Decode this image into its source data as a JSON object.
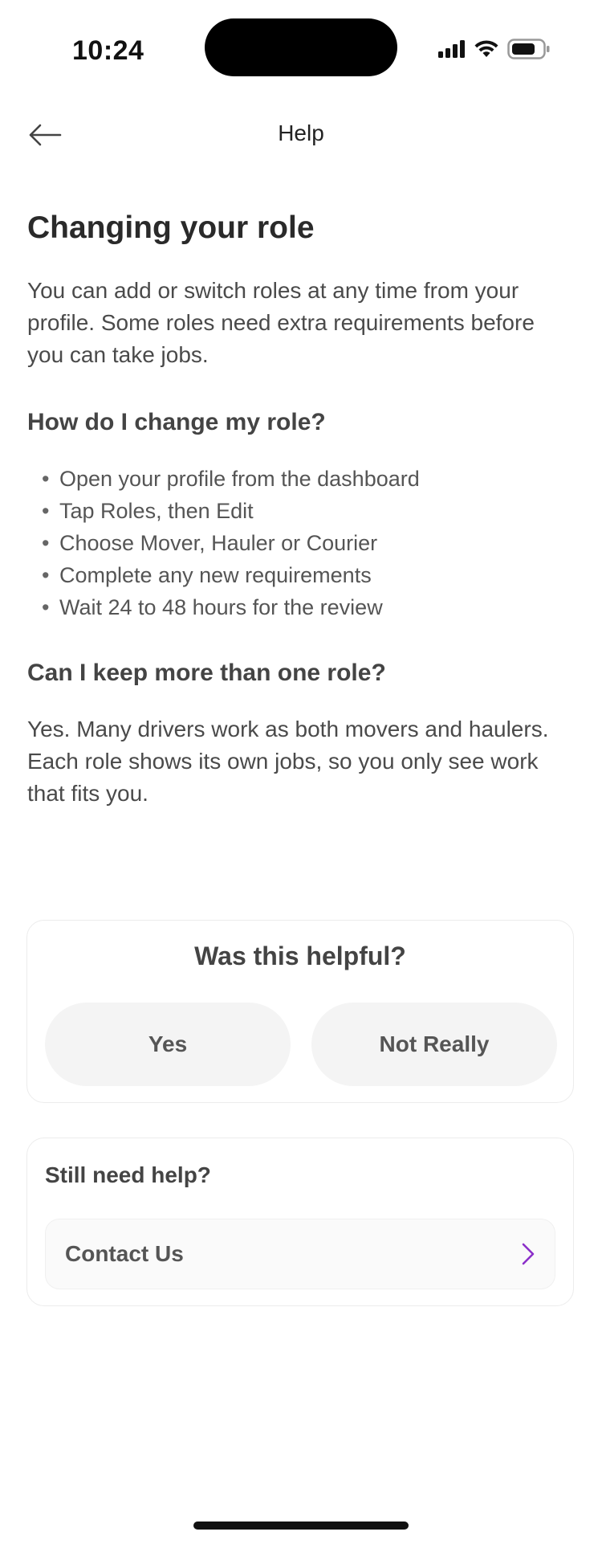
{
  "status_bar": {
    "time": "10:24"
  },
  "header": {
    "title": "Help",
    "back_icon": "arrow-left-icon"
  },
  "article": {
    "title": "Changing your role",
    "intro": "You can add or switch roles at any time from your profile. Some roles need extra requirements before you can take jobs.",
    "sections": [
      {
        "heading": "How do I change my role?",
        "steps": [
          "Open your profile from the dashboard",
          "Tap Roles, then Edit",
          "Choose Mover, Hauler or Courier",
          "Complete any new requirements",
          "Wait 24 to 48 hours for the review"
        ]
      },
      {
        "heading": "Can I keep more than one role?",
        "answer": "Yes. Many drivers work as both movers and haulers. Each role shows its own jobs, so you only see work that fits you."
      }
    ]
  },
  "feedback": {
    "title": "Was this helpful?",
    "yes_label": "Yes",
    "no_label": "Not Really"
  },
  "help": {
    "title": "Still need help?",
    "contact_label": "Contact Us",
    "contact_icon": "chevron-right-icon",
    "accent_color": "#8b2fc9"
  }
}
